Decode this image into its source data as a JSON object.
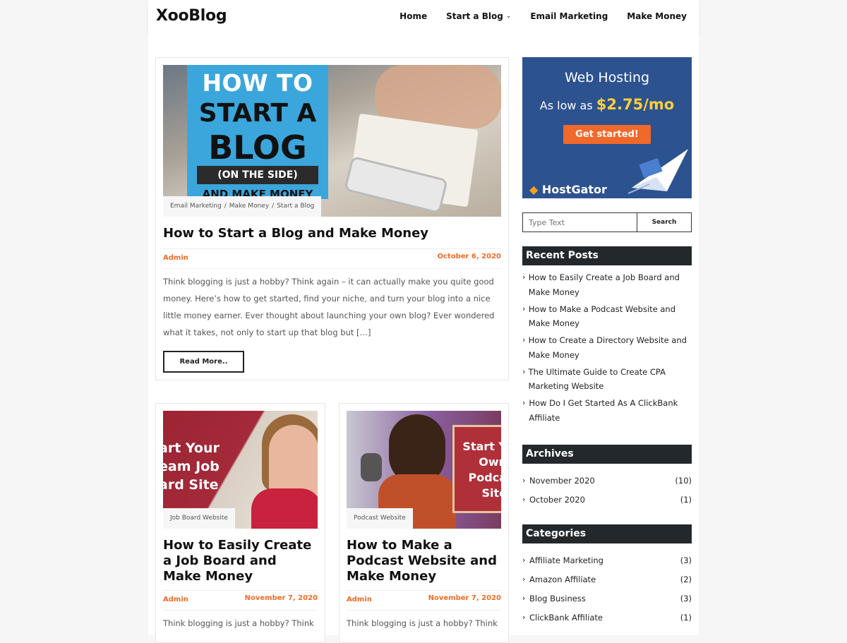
{
  "header": {
    "logo": "XooBlog",
    "nav": [
      {
        "label": "Home"
      },
      {
        "label": "Start a Blog"
      },
      {
        "label": "Email Marketing"
      },
      {
        "label": "Make Money"
      }
    ]
  },
  "featured": {
    "image_text": [
      "HOW TO",
      "START A",
      "BLOG",
      "(ON THE SIDE)",
      "AND MAKE MONEY"
    ],
    "categories": [
      "Email Marketing",
      "Make Money",
      "Start a Blog"
    ],
    "category_separator": "/",
    "title": "How to Start a Blog and Make Money",
    "author": "Admin",
    "date": "October 6, 2020",
    "excerpt": "Think blogging is just a hobby? Think again – it can actually make you quite good money. Here’s how to get started, find your niche, and turn your blog into a nice little money earner. Ever thought about launching your own blog? Ever wondered what it takes, not only to start up that blog but […]",
    "read_more": "Read More.."
  },
  "posts": [
    {
      "image_text": [
        "art Your",
        "eam Job",
        "ard Site"
      ],
      "category": "Job Board Website",
      "title": "How to Easily Create a Job Board and Make Money",
      "author": "Admin",
      "date": "November 7, 2020",
      "excerpt": "Think blogging is just a hobby? Think"
    },
    {
      "image_text": [
        "Start Y",
        "Own",
        "Podca",
        "Site"
      ],
      "category": "Podcast Website",
      "title": "How to Make a Podcast Website and Make Money",
      "author": "Admin",
      "date": "November 7, 2020",
      "excerpt": "Think blogging is just a hobby? Think"
    }
  ],
  "sidebar": {
    "ad": {
      "title": "Web Hosting",
      "price_prefix": "As low as",
      "price": "$2.75/mo",
      "button": "Get started!",
      "brand": "HostGator"
    },
    "search": {
      "placeholder": "Type Text",
      "button": "Search"
    },
    "recent_posts": {
      "title": "Recent Posts",
      "items": [
        "How to Easily Create a Job Board and Make Money",
        "How to Make a Podcast Website and Make Money",
        "How to Create a Directory Website and Make Money",
        "The Ultimate Guide to Create CPA Marketing Website",
        "How Do I Get Started As A ClickBank Affiliate"
      ]
    },
    "archives": {
      "title": "Archives",
      "items": [
        {
          "label": "November 2020",
          "count": "(10)"
        },
        {
          "label": "October 2020",
          "count": "(1)"
        }
      ]
    },
    "categories": {
      "title": "Categories",
      "items": [
        {
          "label": "Affiliate Marketing",
          "count": "(3)"
        },
        {
          "label": "Amazon Affiliate",
          "count": "(2)"
        },
        {
          "label": "Blog Business",
          "count": "(3)"
        },
        {
          "label": "ClickBank Affiliate",
          "count": "(1)"
        }
      ]
    }
  },
  "colors": {
    "accent": "#f26b24",
    "widget_header": "#23282d",
    "ad_background": "#2d5290",
    "ad_button": "#f0682a",
    "ad_price": "#ffcf3a"
  }
}
